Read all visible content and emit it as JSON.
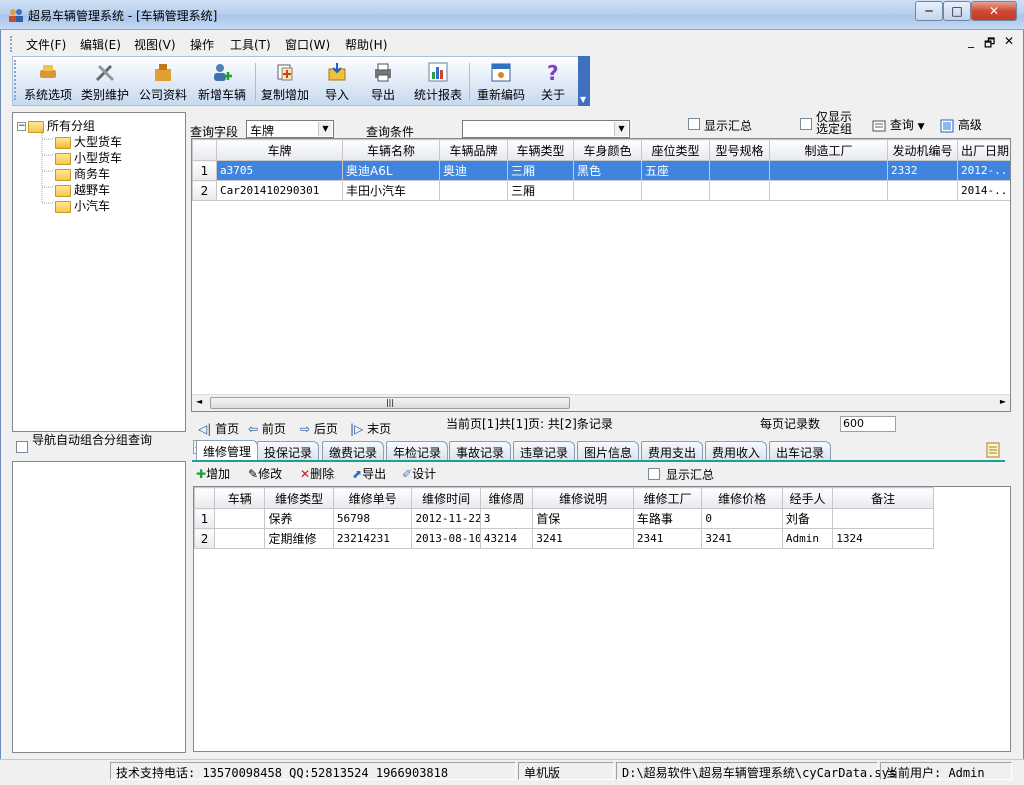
{
  "window": {
    "title": "超易车辆管理系统 - [车辆管理系统]",
    "min": "─",
    "max": "□",
    "close": "✕"
  },
  "menu": [
    "文件(F)",
    "编辑(E)",
    "视图(V)",
    "操作",
    "工具(T)",
    "窗口(W)",
    "帮助(H)"
  ],
  "mdi_controls": [
    "_",
    "🗗",
    "✕"
  ],
  "toolbar": [
    "系统选项",
    "类别维护",
    "公司资料",
    "新增车辆",
    "复制增加",
    "导入",
    "导出",
    "统计报表",
    "重新编码",
    "关于"
  ],
  "tree": {
    "root": "所有分组",
    "children": [
      "大型货车",
      "小型货车",
      "商务车",
      "越野车",
      "小汽车"
    ]
  },
  "nav_auto_group": "导航自动组合分组查询",
  "query": {
    "field_label": "查询字段",
    "field_value": "车牌",
    "cond_label": "查询条件",
    "cond_value": "",
    "show_summary": "显示汇总",
    "only_selected": "仅显示选定组",
    "query_btn": "查询",
    "advanced_btn": "高级"
  },
  "vehicle_table": {
    "columns": [
      "车牌",
      "车辆名称",
      "车辆品牌",
      "车辆类型",
      "车身颜色",
      "座位类型",
      "型号规格",
      "制造工厂",
      "发动机编号",
      "出厂日期"
    ],
    "rows": [
      [
        "1",
        "a3705",
        "奥迪A6L",
        "奥迪",
        "三厢",
        "黑色",
        "五座",
        "",
        "",
        "2332",
        "2012-..."
      ],
      [
        "2",
        "Car201410290301",
        "丰田小汽车",
        "",
        "三厢",
        "",
        "",
        "",
        "",
        "",
        "2014-..."
      ]
    ]
  },
  "pager": {
    "first": "首页",
    "prev": "前页",
    "next": "后页",
    "last": "末页",
    "info": "当前页[1]共[1]页: 共[2]条记录",
    "per_page_label": "每页记录数",
    "per_page_value": "600"
  },
  "tabs": [
    "维修管理",
    "投保记录",
    "缴费记录",
    "年检记录",
    "事故记录",
    "违章记录",
    "图片信息",
    "费用支出",
    "费用收入",
    "出车记录"
  ],
  "sub_toolbar": {
    "add": "增加",
    "edit": "修改",
    "delete": "删除",
    "export": "导出",
    "design": "设计",
    "show_summary": "显示汇总"
  },
  "repair_table": {
    "columns": [
      "车辆",
      "维修类型",
      "维修单号",
      "维修时间",
      "维修周",
      "维修说明",
      "维修工厂",
      "维修价格",
      "经手人",
      "备注"
    ],
    "rows": [
      [
        "1",
        "",
        "保养",
        "56798",
        "2012-11-22",
        "3",
        "首保",
        "车路事",
        "0",
        "刘备",
        ""
      ],
      [
        "2",
        "",
        "定期维修",
        "23214231",
        "2013-08-10",
        "43214",
        "3241",
        "2341",
        "3241",
        "Admin",
        "1324"
      ]
    ]
  },
  "status": {
    "support": "技术支持电话: 13570098458 QQ:52813524 1966903818",
    "edition": "单机版",
    "path": "D:\\超易软件\\超易车辆管理系统\\cyCarData.sys",
    "user": "当前用户: Admin"
  },
  "colors": {
    "selection": "#3f85e0",
    "titlebar": "#b9d1ee",
    "close": "#c63a22"
  }
}
